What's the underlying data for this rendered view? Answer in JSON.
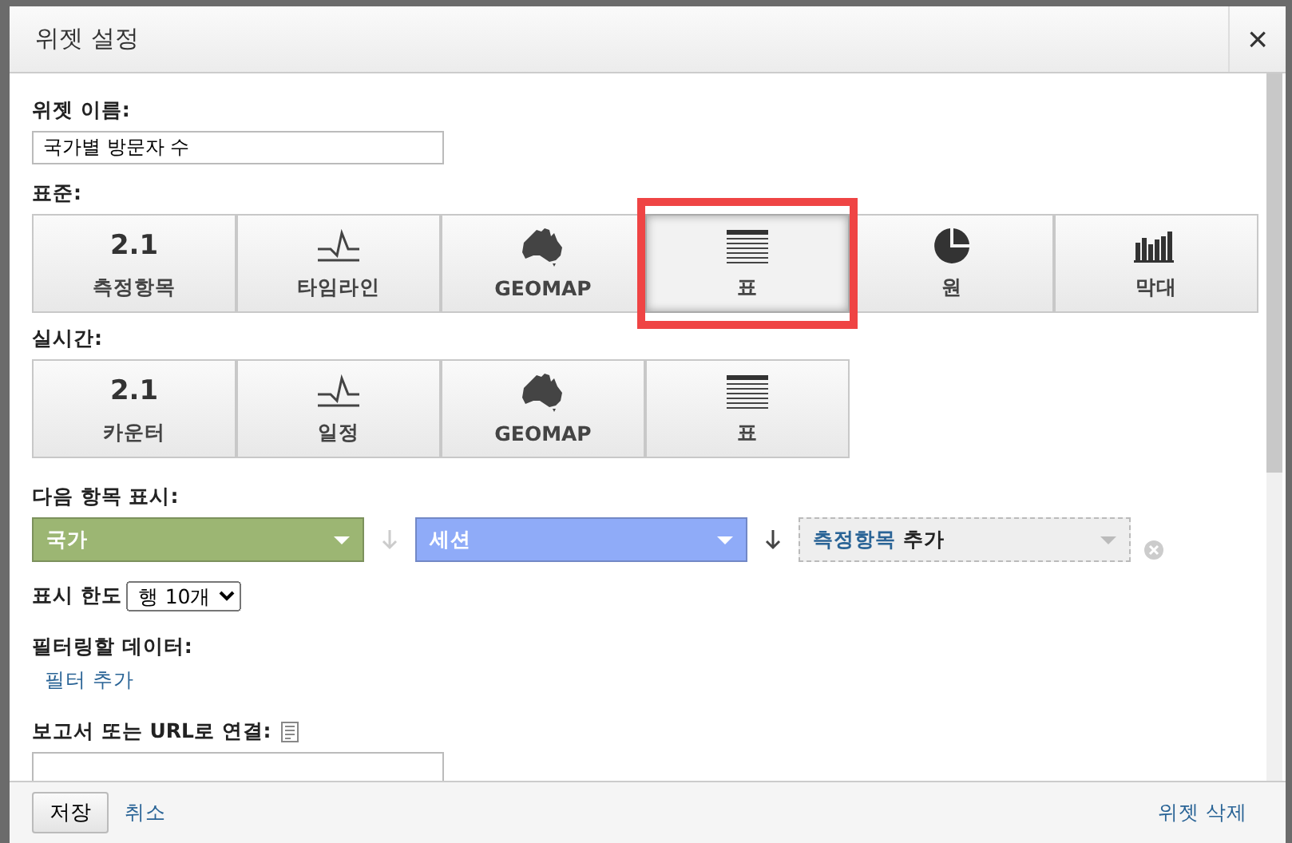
{
  "window": {
    "title": "위젯 설정",
    "close": "×"
  },
  "widget_name": {
    "label": "위젯 이름:",
    "value": "국가별 방문자 수"
  },
  "standard": {
    "label": "표준:",
    "options": [
      {
        "kind": "number",
        "icon_text": "2.1",
        "label": "측정항목",
        "selected": false,
        "highlighted": false
      },
      {
        "kind": "timeline",
        "label": "타임라인",
        "selected": false,
        "highlighted": false
      },
      {
        "kind": "geomap",
        "label": "GEOMAP",
        "selected": false,
        "highlighted": false
      },
      {
        "kind": "table",
        "label": "표",
        "selected": true,
        "highlighted": true
      },
      {
        "kind": "pie",
        "label": "원",
        "selected": false,
        "highlighted": false
      },
      {
        "kind": "bar",
        "label": "막대",
        "selected": false,
        "highlighted": false
      }
    ]
  },
  "realtime": {
    "label": "실시간:",
    "options": [
      {
        "kind": "number",
        "icon_text": "2.1",
        "label": "카운터",
        "selected": false,
        "highlighted": false
      },
      {
        "kind": "timeline",
        "label": "일정",
        "selected": false,
        "highlighted": false
      },
      {
        "kind": "geomap",
        "label": "GEOMAP",
        "selected": false,
        "highlighted": false
      },
      {
        "kind": "table",
        "label": "표",
        "selected": false,
        "highlighted": false
      }
    ]
  },
  "show_items": {
    "label": "다음 항목 표시:",
    "dimension": {
      "value": "국가",
      "color": "#9cb673"
    },
    "metric": {
      "value": "세션",
      "color": "#8fabf8"
    },
    "add_metric": {
      "link": "측정항목",
      "text": "추가"
    }
  },
  "limit": {
    "label": "표시 한도",
    "value": "행 10개"
  },
  "filter": {
    "label": "필터링할 데이터:",
    "link": "필터 추가"
  },
  "link_to": {
    "label": "보고서 또는 URL로 연결:"
  },
  "footer": {
    "save": "저장",
    "cancel": "취소",
    "delete": "위젯 삭제"
  }
}
